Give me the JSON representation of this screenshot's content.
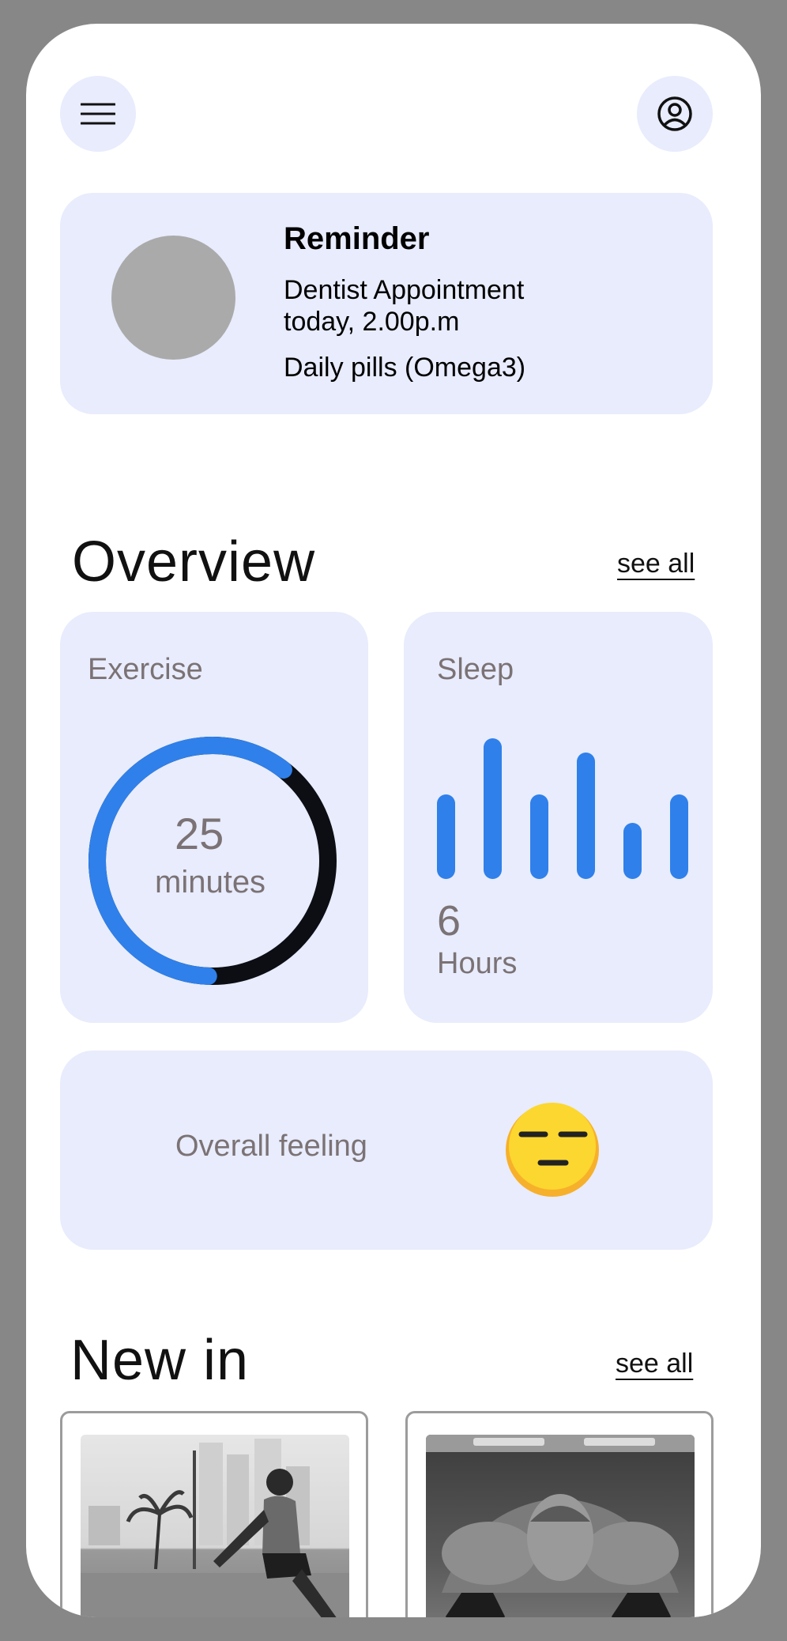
{
  "header": {
    "menu_icon": "hamburger-menu-icon",
    "profile_icon": "user-circle-icon"
  },
  "reminder": {
    "title": "Reminder",
    "line1": "Dentist Appointment",
    "line2": "today, 2.00p.m",
    "line3": "Daily pills (Omega3)"
  },
  "overview": {
    "title": "Overview",
    "see_all": "see all",
    "exercise": {
      "label": "Exercise",
      "value": "25",
      "unit": "minutes",
      "progress_fraction": 0.6
    },
    "sleep": {
      "label": "Sleep",
      "value": "6",
      "unit": "Hours",
      "bar_levels": [
        0.6,
        1.0,
        0.6,
        0.9,
        0.4,
        0.6
      ]
    },
    "feeling": {
      "label": "Overall feeling",
      "emoji_icon": "expressionless-face-icon"
    }
  },
  "new_in": {
    "title": "New in",
    "see_all": "see all",
    "items": [
      {
        "image": "man-stretching-outdoors-photo"
      },
      {
        "image": "man-doing-pushups-on-dumbbells-photo"
      }
    ]
  },
  "colors": {
    "card_bg": "#e8ecfc",
    "accent": "#2f80ea",
    "ring_dark": "#0c0e14",
    "muted_text": "#7b7275",
    "frame": "#878787"
  }
}
